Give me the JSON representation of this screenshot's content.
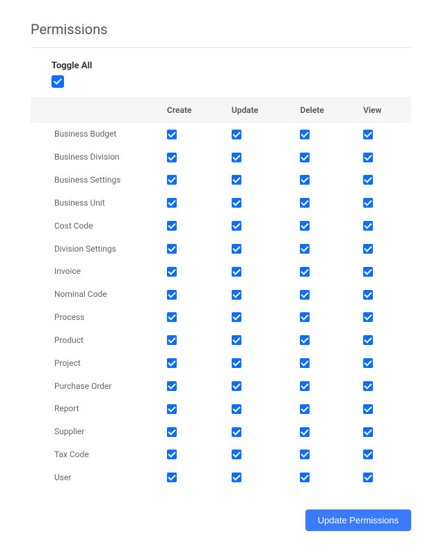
{
  "title": "Permissions",
  "toggle_all_label": "Toggle All",
  "toggle_all_checked": true,
  "columns": [
    "Create",
    "Update",
    "Delete",
    "View"
  ],
  "rows": [
    {
      "name": "Business Budget",
      "values": [
        true,
        true,
        true,
        true
      ]
    },
    {
      "name": "Business Division",
      "values": [
        true,
        true,
        true,
        true
      ]
    },
    {
      "name": "Business Settings",
      "values": [
        true,
        true,
        true,
        true
      ]
    },
    {
      "name": "Business Unit",
      "values": [
        true,
        true,
        true,
        true
      ]
    },
    {
      "name": "Cost Code",
      "values": [
        true,
        true,
        true,
        true
      ]
    },
    {
      "name": "Division Settings",
      "values": [
        true,
        true,
        true,
        true
      ]
    },
    {
      "name": "Invoice",
      "values": [
        true,
        true,
        true,
        true
      ]
    },
    {
      "name": "Nominal Code",
      "values": [
        true,
        true,
        true,
        true
      ]
    },
    {
      "name": "Process",
      "values": [
        true,
        true,
        true,
        true
      ]
    },
    {
      "name": "Product",
      "values": [
        true,
        true,
        true,
        true
      ]
    },
    {
      "name": "Project",
      "values": [
        true,
        true,
        true,
        true
      ]
    },
    {
      "name": "Purchase Order",
      "values": [
        true,
        true,
        true,
        true
      ]
    },
    {
      "name": "Report",
      "values": [
        true,
        true,
        true,
        true
      ]
    },
    {
      "name": "Supplier",
      "values": [
        true,
        true,
        true,
        true
      ]
    },
    {
      "name": "Tax Code",
      "values": [
        true,
        true,
        true,
        true
      ]
    },
    {
      "name": "User",
      "values": [
        true,
        true,
        true,
        true
      ]
    }
  ],
  "update_button": "Update Permissions"
}
